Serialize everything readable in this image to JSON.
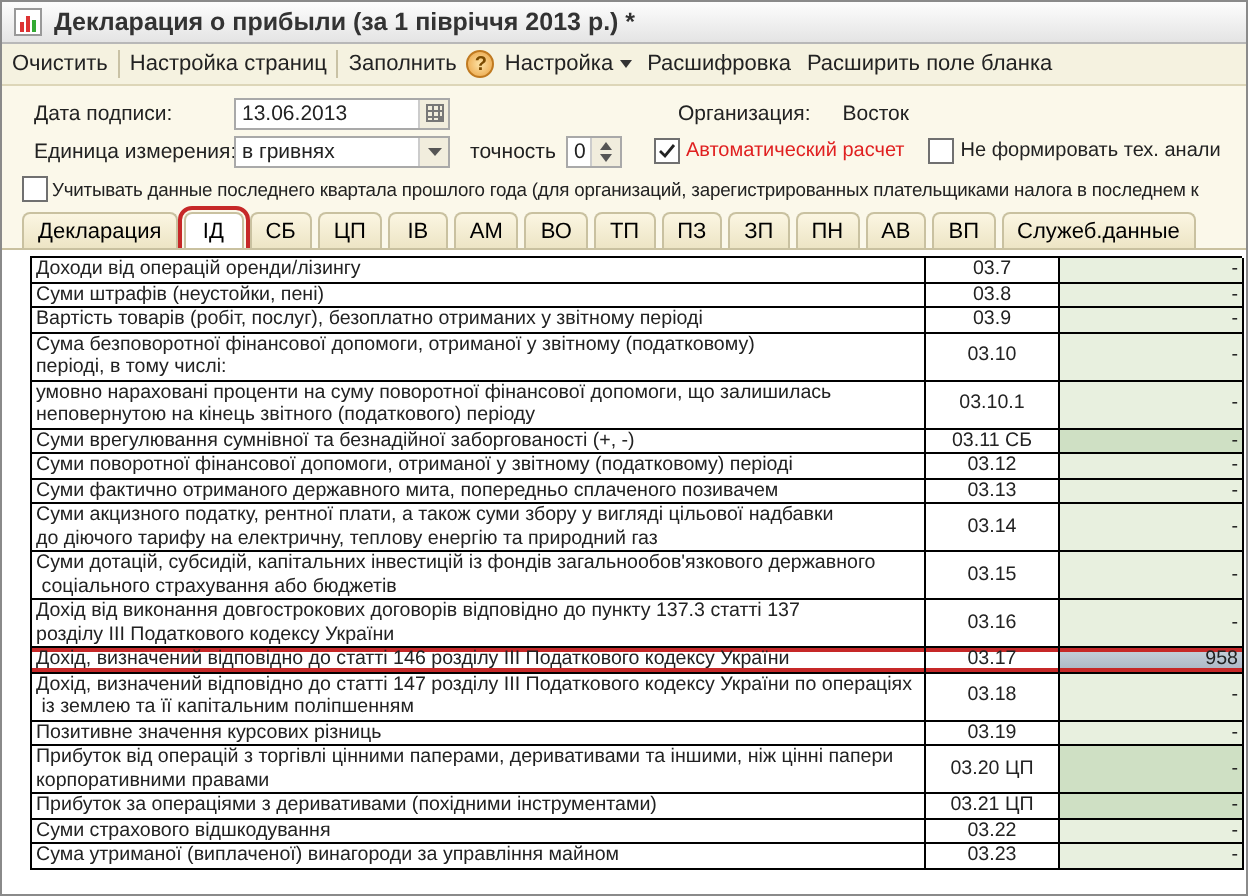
{
  "window": {
    "title": "Декларация о прибыли (за 1 півріччя 2013 р.) *"
  },
  "toolbar": [
    {
      "kind": "button",
      "label": "Очистить"
    },
    {
      "kind": "separator"
    },
    {
      "kind": "button",
      "label": "Настройка страниц"
    },
    {
      "kind": "separator"
    },
    {
      "kind": "button",
      "label": "Заполнить"
    },
    {
      "kind": "help",
      "label": "?"
    },
    {
      "kind": "menu",
      "label": "Настройка"
    },
    {
      "kind": "button",
      "label": "Расшифровка"
    },
    {
      "kind": "button",
      "label": "Расширить поле бланка"
    }
  ],
  "form": {
    "date_label": "Дата подписи:",
    "date_value": "13.06.2013",
    "unit_label": "Единица измерения:",
    "unit_value": "в гривнях",
    "precision_label": "точность",
    "precision_value": "0",
    "org_label": "Организация:",
    "org_value": "Восток",
    "auto_calc": {
      "label": "Автоматический расчет",
      "checked": true
    },
    "no_tech": {
      "label": "Не формировать тех. анали",
      "checked": false
    },
    "last_quarter": {
      "label": "Учитывать данные последнего квартала прошлого года (для организаций, зарегистрированных плательщиками налога в последнем к",
      "checked": false
    }
  },
  "tabs": [
    {
      "label": "Декларация",
      "selected": false
    },
    {
      "label": "ІД",
      "selected": true
    },
    {
      "label": "СБ",
      "selected": false
    },
    {
      "label": "ЦП",
      "selected": false
    },
    {
      "label": "ІВ",
      "selected": false
    },
    {
      "label": "АМ",
      "selected": false
    },
    {
      "label": "ВО",
      "selected": false
    },
    {
      "label": "ТП",
      "selected": false
    },
    {
      "label": "ПЗ",
      "selected": false
    },
    {
      "label": "ЗП",
      "selected": false
    },
    {
      "label": "ПН",
      "selected": false
    },
    {
      "label": "АВ",
      "selected": false
    },
    {
      "label": "ВП",
      "selected": false
    },
    {
      "label": "Служеб.данные",
      "selected": false
    }
  ],
  "rows": [
    {
      "text": "Доходи від операцій оренди/лізингу",
      "code": "03.7",
      "value": "-",
      "linked": false,
      "selected": false
    },
    {
      "text": "Суми штрафів (неустойки, пені)",
      "code": "03.8",
      "value": "-",
      "linked": false,
      "selected": false
    },
    {
      "text": "Вартість товарів (робіт, послуг), безоплатно отриманих у звітному періоді",
      "code": "03.9",
      "value": "-",
      "linked": false,
      "selected": false
    },
    {
      "text": "Сума безповоротної фінансової допомоги, отриманої у звітному (податковому)\nперіоді, в тому числі:",
      "code": "03.10",
      "value": "-",
      "linked": false,
      "selected": false
    },
    {
      "text": "умовно нараховані проценти на суму поворотної фінансової допомоги, що залишилась\nнеповернутою на кінець звітного (податкового) періоду",
      "code": "03.10.1",
      "value": "-",
      "linked": false,
      "selected": false
    },
    {
      "text": "Суми врегулювання сумнівної та безнадійної заборгованості (+, -)",
      "code": "03.11 СБ",
      "value": "-",
      "linked": true,
      "selected": false
    },
    {
      "text": "Суми поворотної фінансової допомоги, отриманої у звітному (податковому) періоді",
      "code": "03.12",
      "value": "-",
      "linked": false,
      "selected": false
    },
    {
      "text": "Суми фактично отриманого державного мита, попередньо сплаченого позивачем",
      "code": "03.13",
      "value": "-",
      "linked": false,
      "selected": false
    },
    {
      "text": "Суми акцизного податку, рентної плати, а також суми збору у вигляді цільової надбавки\nдо діючого тарифу на електричну, теплову енергію та природний газ",
      "code": "03.14",
      "value": "-",
      "linked": false,
      "selected": false
    },
    {
      "text": "Суми дотацій, субсидій, капітальних інвестицій із фондів загальнообов'язкового державного\n соціального страхування або бюджетів",
      "code": "03.15",
      "value": "-",
      "linked": false,
      "selected": false
    },
    {
      "text": "Дохід від виконання довгострокових договорів відповідно до пункту 137.3 статті 137\nрозділу ІІІ Податкового кодексу України",
      "code": "03.16",
      "value": "-",
      "linked": false,
      "selected": false
    },
    {
      "text": "Дохід, визначений відповідно до статті 146 розділу ІІІ Податкового кодексу України",
      "code": "03.17",
      "value": "958",
      "linked": false,
      "selected": true
    },
    {
      "text": "Дохід, визначений відповідно до статті 147 розділу ІІІ Податкового кодексу України по операціях\n із землею та її капітальним поліпшенням",
      "code": "03.18",
      "value": "-",
      "linked": false,
      "selected": false
    },
    {
      "text": "Позитивне значення курсових різниць",
      "code": "03.19",
      "value": "-",
      "linked": false,
      "selected": false
    },
    {
      "text": "Прибуток від операцій з торгівлі цінними паперами, деривативами та іншими, ніж цінні папери\nкорпоративними правами",
      "code": "03.20 ЦП",
      "value": "-",
      "linked": true,
      "selected": false
    },
    {
      "text": "Прибуток за операціями з деривативами (похідними інструментами)",
      "code": "03.21 ЦП",
      "value": "-",
      "linked": true,
      "selected": false
    },
    {
      "text": "Суми страхового відшкодування",
      "code": "03.22",
      "value": "-",
      "linked": false,
      "selected": false
    },
    {
      "text": "Сума утриманої (виплаченої) винагороди за управління майном",
      "code": "03.23",
      "value": "-",
      "linked": false,
      "selected": false
    }
  ]
}
